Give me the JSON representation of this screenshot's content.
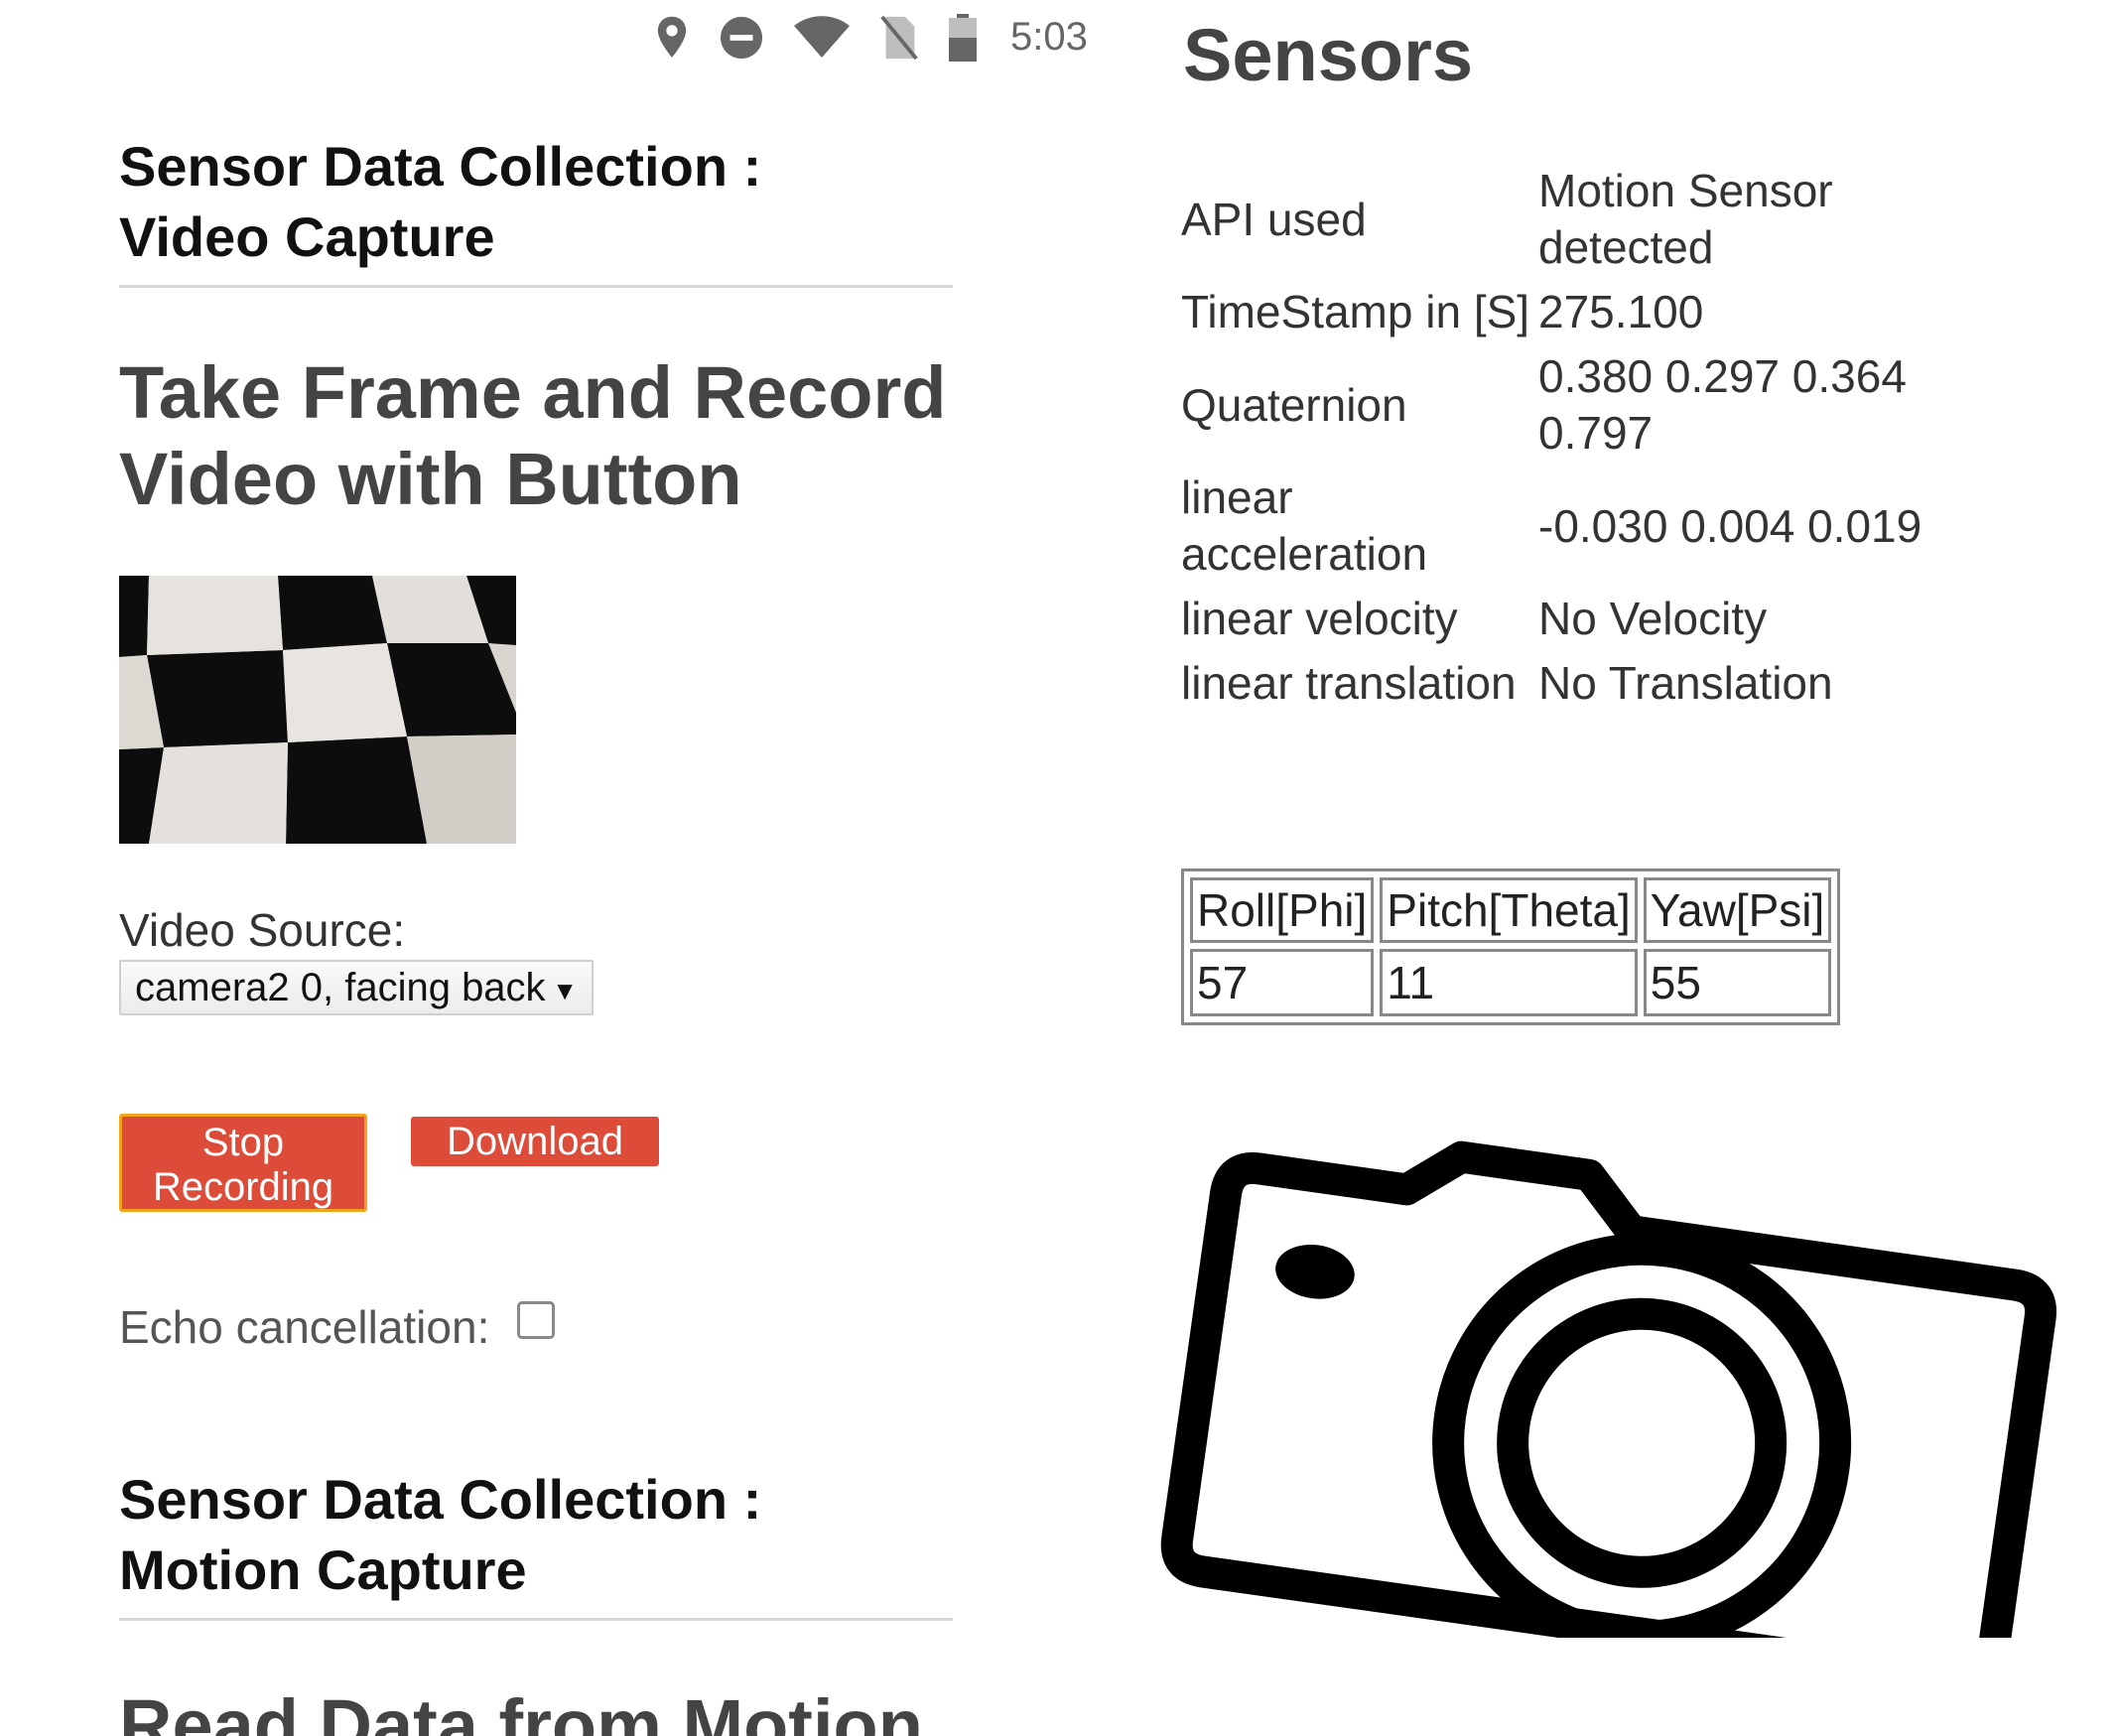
{
  "status_bar": {
    "icons": [
      "location-icon",
      "dnd-icon",
      "wifi-icon",
      "no-sim-icon",
      "battery-icon"
    ],
    "time": "5:03"
  },
  "video_section": {
    "title_line1": "Sensor Data Collection :",
    "title_line2": "Video Capture",
    "heading_line1": "Take Frame and Record",
    "heading_line2": "Video with Button",
    "video_source_label": "Video Source:",
    "video_source_value": "camera2 0, facing back",
    "stop_button_line1": "Stop",
    "stop_button_line2": "Recording",
    "download_button": "Download",
    "echo_label": "Echo cancellation:",
    "echo_checked": false
  },
  "motion_section": {
    "title_line1": "Sensor Data Collection :",
    "title_line2": "Motion Capture",
    "heading_line1": "Read Data from Motion",
    "heading_line2": "Sensors"
  },
  "sensor_info": {
    "rows": [
      {
        "label": "API used",
        "value": "Motion Sensor detected"
      },
      {
        "label": "TimeStamp in [S]",
        "value": "275.100"
      },
      {
        "label": "Quaternion",
        "value": "0.380 0.297 0.364 0.797"
      },
      {
        "label": "linear acceleration",
        "value": "-0.030 0.004 0.019"
      },
      {
        "label": "linear velocity",
        "value": "No Velocity"
      },
      {
        "label": "linear translation",
        "value": "No Translation"
      }
    ]
  },
  "angles": {
    "headers": [
      "Roll[Phi]",
      "Pitch[Theta]",
      "Yaw[Psi]"
    ],
    "values": [
      "57",
      "11",
      "55"
    ]
  },
  "colors": {
    "button_red": "#dd4b39",
    "focus_orange": "#f2a51a"
  }
}
